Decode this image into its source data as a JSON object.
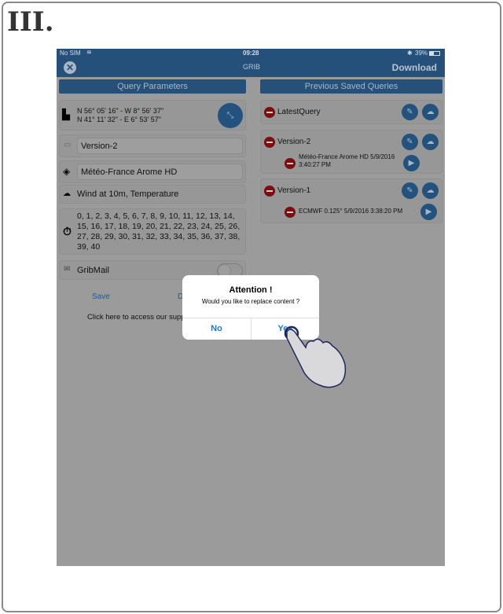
{
  "step_label": "III.",
  "status": {
    "carrier": "No SIM",
    "time": "09:28",
    "battery": "39%"
  },
  "nav": {
    "title": "GRIB",
    "download": "Download"
  },
  "left": {
    "header": "Query Parameters",
    "coords": [
      "N 56° 05' 16\" - W 8° 56' 37\"",
      "N 41° 11' 32\" - E 6° 53' 57\""
    ],
    "name": "Version-2",
    "model": "Météo-France Arome HD",
    "parameters": "Wind at 10m, Temperature",
    "hours": "0, 1, 2, 3, 4, 5, 6, 7, 8, 9, 10, 11, 12, 13, 14, 15, 16, 17, 18, 19, 20, 21, 22, 23, 24, 25, 26, 27, 28, 29, 30, 31, 32, 33, 34, 35, 36, 37, 38, 39, 40",
    "gribmail": "GribMail",
    "gribmail_on": false,
    "save": "Save",
    "download_partial": "D",
    "support": "Click here to access our supp"
  },
  "right": {
    "header": "Previous Saved Queries",
    "queries": [
      {
        "name": "LatestQuery"
      },
      {
        "name": "Version-2",
        "sub": "Météo-France Arome HD 5/9/2016 3:40:27 PM"
      },
      {
        "name": "Version-1",
        "sub": "ECMWF 0.125° 5/9/2016 3:38:20 PM"
      }
    ]
  },
  "dialog": {
    "title": "Attention !",
    "message": "Would you like to replace content ?",
    "no": "No",
    "yes": "Yes"
  },
  "colors": {
    "nav": "#24507a",
    "accent": "#1a7be0",
    "delete": "#7d0e10"
  }
}
